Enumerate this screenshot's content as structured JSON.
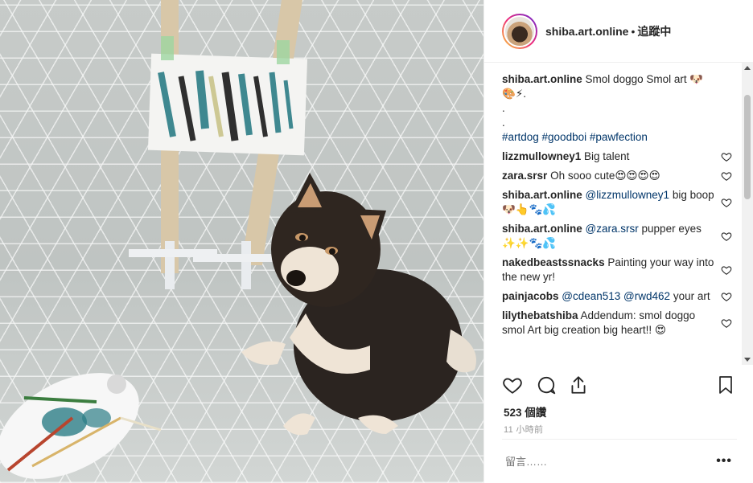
{
  "header": {
    "username": "shiba.art.online",
    "separator": "•",
    "follow_label": "追蹤中"
  },
  "comments": [
    {
      "user": "shiba.art.online",
      "text": "Smol doggo Smol art 🐶🎨⚡.",
      "dots": [
        ".",
        "."
      ],
      "hashtags": "#artdog #goodboi #pawfection",
      "is_caption": true
    },
    {
      "user": "lizzmullowney1",
      "text": "Big talent"
    },
    {
      "user": "zara.srsr",
      "text": "Oh sooo cute😍😍😍😍"
    },
    {
      "user": "shiba.art.online",
      "mention": "@lizzmullowney1",
      "text": "big boop 🐶👆🐾💦"
    },
    {
      "user": "shiba.art.online",
      "mention": "@zara.srsr",
      "text": "pupper eyes ✨✨🐾💦"
    },
    {
      "user": "nakedbeastssnacks",
      "text": "Painting your way into the new yr!"
    },
    {
      "user": "painjacobs",
      "mention": "@cdean513 @rwd462",
      "text": "your art"
    },
    {
      "user": "lilythebatshiba",
      "text": "Addendum: smol doggo smol Art big creation big heart!! 😍"
    }
  ],
  "actions": {
    "like_icon": "heart-icon",
    "comment_icon": "comment-icon",
    "share_icon": "share-icon",
    "save_icon": "bookmark-icon"
  },
  "likes": "523 個讚",
  "time": "11 小時前",
  "comment_placeholder": "留言……",
  "more_label": "•••",
  "colors": {
    "link": "#003569",
    "text": "#262626",
    "muted": "#999999"
  }
}
